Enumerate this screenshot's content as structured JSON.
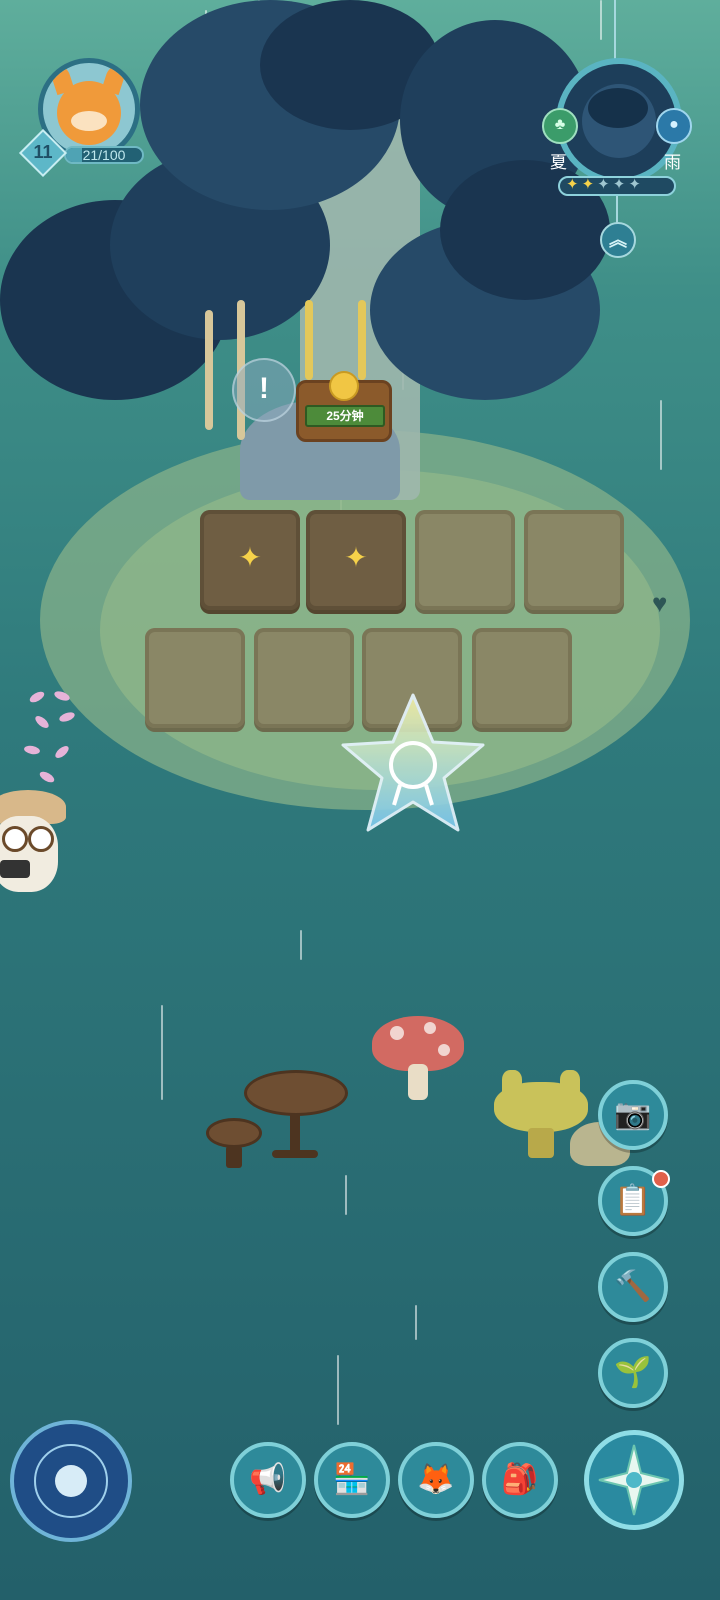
{
  "player": {
    "level": "11",
    "exp_text": "21/100",
    "exp_progress": 0.21
  },
  "weather": {
    "season": "夏",
    "condition": "雨",
    "stars_filled": 2,
    "stars_total": 5
  },
  "plot_sign": {
    "timer_text": "25分钟"
  },
  "plots": [
    {
      "state": "sprouted"
    },
    {
      "state": "sprouted"
    },
    {
      "state": "empty"
    },
    {
      "state": "empty"
    },
    {
      "state": "empty"
    },
    {
      "state": "empty"
    },
    {
      "state": "empty"
    },
    {
      "state": "empty"
    }
  ],
  "side_menu": [
    "camera-icon",
    "clipboard-icon",
    "hammer-icon",
    "sprout-icon"
  ],
  "bottom_bar": [
    "compass-wheel-icon",
    "megaphone-icon",
    "shop-icon",
    "fox-friend-icon",
    "backpack-icon",
    "compass-star-icon"
  ],
  "colors": {
    "accent_ring": "#7fd0d8",
    "button_fill": "#2e8a9a",
    "plot_soil": "#8a8766",
    "sign_wood": "#8b5a2b"
  }
}
